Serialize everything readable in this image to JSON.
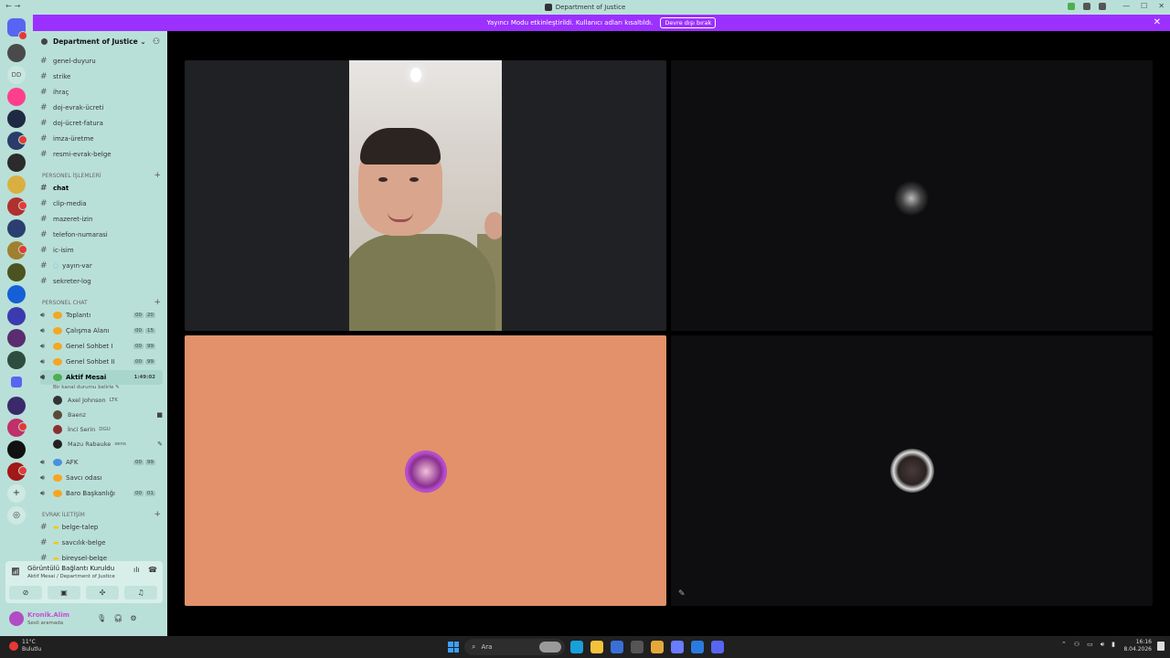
{
  "window": {
    "title": "Department of Justice",
    "nav_back": "←",
    "nav_forward": "→",
    "controls": [
      "—",
      "☐",
      "✕"
    ]
  },
  "banner": {
    "message": "Yayıncı Modu etkinleştirildi. Kullanıcı adları kısaltıldı.",
    "button": "Devre dışı bırak",
    "close": "✕"
  },
  "guild": {
    "name": "Department of Justice",
    "chevron": "⌄",
    "rail_label": "DD"
  },
  "channels_top": [
    {
      "name": "genel-duyuru"
    },
    {
      "name": "strike"
    },
    {
      "name": "ihraç"
    },
    {
      "name": "doj-evrak-ücreti"
    },
    {
      "name": "doj-ücret-fatura"
    },
    {
      "name": "imza-üretme"
    },
    {
      "name": "resmi-evrak-belge"
    }
  ],
  "category_personel_islemleri": "PERSONEL İŞLEMLERİ",
  "channels_personel": [
    {
      "name": "chat",
      "bold": true
    },
    {
      "name": "clip-media"
    },
    {
      "name": "mazeret-izin"
    },
    {
      "name": "telefon-numarasi"
    },
    {
      "name": "ic-isim"
    },
    {
      "name": "yayın-var"
    },
    {
      "name": "sekreter-log"
    }
  ],
  "category_personel_chat": "PERSONEL CHAT",
  "voice_channels": [
    {
      "name": "Toplantı",
      "count_a": "00",
      "count_b": "20"
    },
    {
      "name": "Çalışma Alanı",
      "count_a": "00",
      "count_b": "15"
    },
    {
      "name": "Genel Sohbet I",
      "count_a": "00",
      "count_b": "99"
    },
    {
      "name": "Genel Sohbet II",
      "count_a": "00",
      "count_b": "99"
    }
  ],
  "active_voice": {
    "name": "Aktif Mesai",
    "timer": "1:49:02",
    "status": "Bir kanal durumu belirle",
    "members": [
      {
        "name": "Axel Johnson",
        "tag": "LTK",
        "icon": ""
      },
      {
        "name": "Baenz",
        "tag": "",
        "icon": "■"
      },
      {
        "name": "İnci Serin",
        "tag": "DGU",
        "icon": ""
      },
      {
        "name": "Mazu Rabauke",
        "tag": "sens",
        "icon": "✎"
      }
    ]
  },
  "voice_channels_2": [
    {
      "name": "AFK",
      "count_a": "00",
      "count_b": "99"
    },
    {
      "name": "Savcı odası",
      "count_a": "",
      "count_b": ""
    },
    {
      "name": "Baro Başkanlığı",
      "count_a": "00",
      "count_b": "01"
    }
  ],
  "category_evrak": "EVRAK İLETİŞİM",
  "channels_evrak": [
    {
      "name": "belge-talep"
    },
    {
      "name": "savcılık-belge"
    },
    {
      "name": "bireysel-belge"
    }
  ],
  "connection": {
    "title": "Görüntülü Bağlantı Kuruldu",
    "subtitle": "Aktif Mesai / Department of Justice"
  },
  "user": {
    "name": "Kronik.Alim",
    "status": "Sesli aramada"
  },
  "taskbar": {
    "temperature": "11°C",
    "weather": "Bulutlu",
    "search_placeholder": "Ara",
    "time": "16:16",
    "date": "8.04.2026"
  },
  "colors": {
    "banner": "#9b30ff",
    "sidebar": "#b9e0d8",
    "tile_orange": "#e2916a",
    "username": "#c44dd8"
  }
}
